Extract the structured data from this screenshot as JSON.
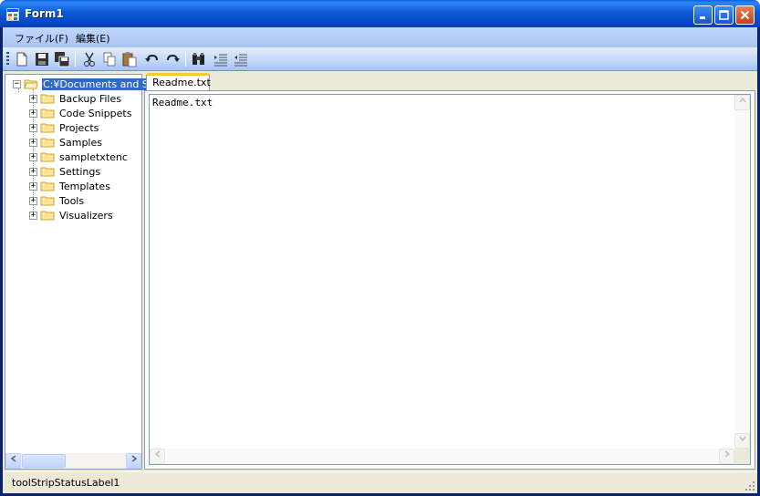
{
  "window": {
    "title": "Form1",
    "buttons": {
      "minimize": "_",
      "maximize": "□",
      "close": "✕"
    }
  },
  "menu": {
    "items": [
      "ファイル(F)",
      "編集(E)"
    ]
  },
  "toolbar": {
    "icons": [
      "new-file-icon",
      "save-icon",
      "save-all-icon",
      "cut-icon",
      "copy-icon",
      "paste-icon",
      "undo-icon",
      "redo-icon",
      "find-icon",
      "indent-icon",
      "outdent-icon"
    ]
  },
  "tree": {
    "root": "C:¥Documents and S",
    "children": [
      "Backup Files",
      "Code Snippets",
      "Projects",
      "Samples",
      "sampletxtenc",
      "Settings",
      "Templates",
      "Tools",
      "Visualizers"
    ],
    "expand_symbol": "+",
    "collapse_symbol": "−"
  },
  "tabs": [
    {
      "label": "Readme.txt",
      "selected": true
    }
  ],
  "editor": {
    "content": "Readme.txt"
  },
  "statusbar": {
    "label": "toolStripStatusLabel1"
  },
  "scroll": {
    "left": "<",
    "right": ">",
    "up": "^",
    "down": "v"
  },
  "colors": {
    "titlebar": "#0a5ad8",
    "selection": "#316ac5",
    "tab_accent": "#ffc83c"
  }
}
